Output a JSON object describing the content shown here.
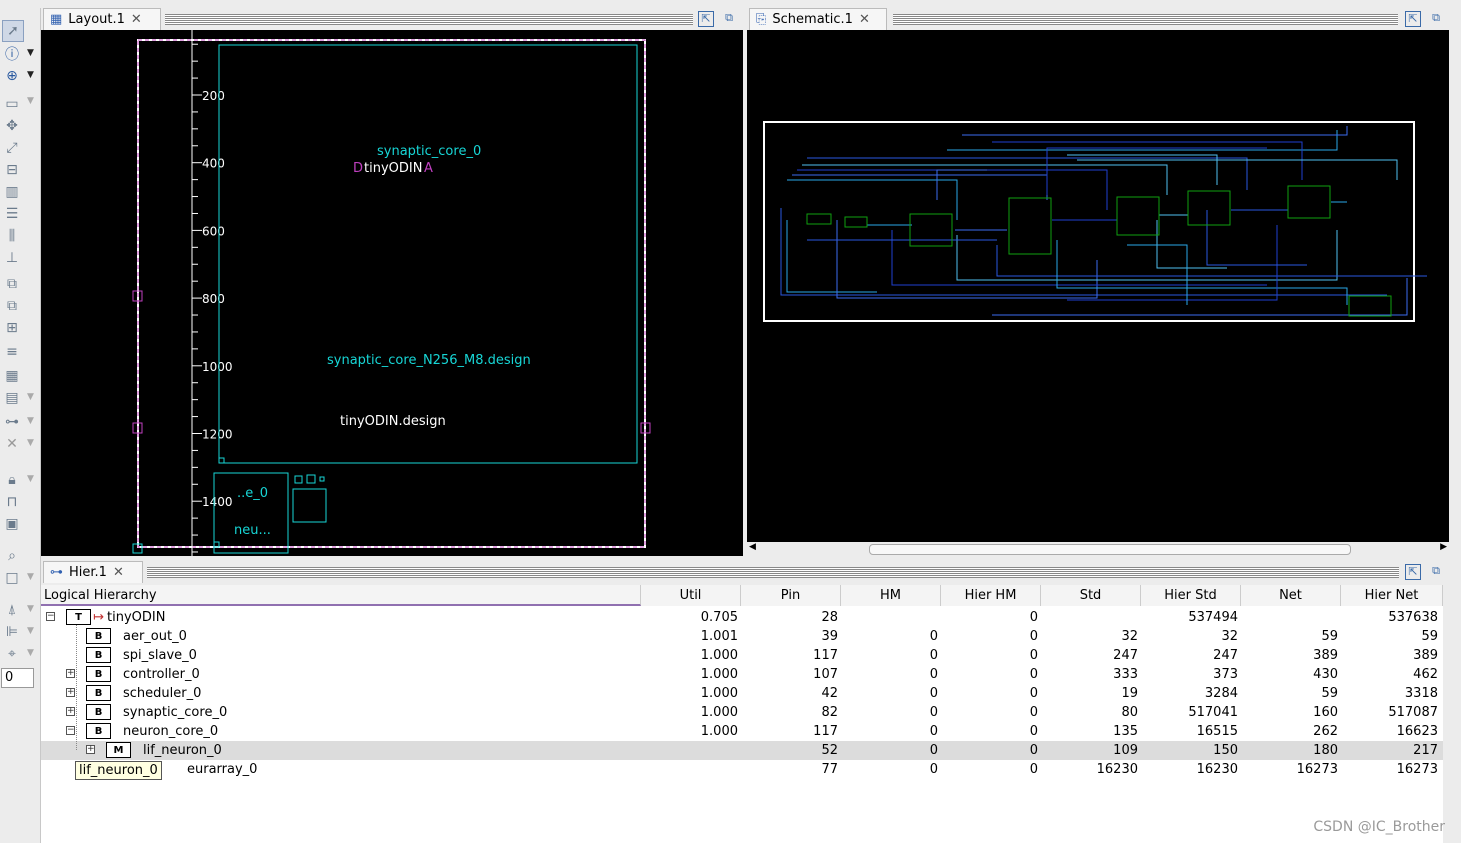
{
  "toolbar": {
    "zoom_value": "0"
  },
  "layout_tab": {
    "title": "Layout.1"
  },
  "schematic_tab": {
    "title": "Schematic.1"
  },
  "hier_tab": {
    "title": "Hier.1"
  },
  "layout": {
    "ruler_labels": [
      "200",
      "400",
      "600",
      "800",
      "1000",
      "1200",
      "1400"
    ],
    "labels": {
      "synaptic_core": "synaptic_core_0",
      "tinyodin": "tinyODIN",
      "overlap_left": "D",
      "overlap_right": "A",
      "synaptic_design": "synaptic_core_N256_M8.design",
      "tinyodin_design": "tinyODIN.design",
      "e0": "..e_0",
      "neu": "neu..."
    }
  },
  "hier": {
    "columns": [
      "Logical Hierarchy",
      "Util",
      "Pin",
      "HM",
      "Hier HM",
      "Std",
      "Hier Std",
      "Net",
      "Hier Net"
    ],
    "rows": [
      {
        "badge": "T",
        "name": "tinyODIN",
        "util": "0.705",
        "pin": "28",
        "hm": "",
        "hier_hm": "0",
        "std": "",
        "hier_std": "537494",
        "net": "",
        "hier_net": "537638"
      },
      {
        "badge": "B",
        "name": "aer_out_0",
        "util": "1.001",
        "pin": "39",
        "hm": "0",
        "hier_hm": "0",
        "std": "32",
        "hier_std": "32",
        "net": "59",
        "hier_net": "59"
      },
      {
        "badge": "B",
        "name": "spi_slave_0",
        "util": "1.000",
        "pin": "117",
        "hm": "0",
        "hier_hm": "0",
        "std": "247",
        "hier_std": "247",
        "net": "389",
        "hier_net": "389"
      },
      {
        "badge": "B",
        "name": "controller_0",
        "util": "1.000",
        "pin": "107",
        "hm": "0",
        "hier_hm": "0",
        "std": "333",
        "hier_std": "373",
        "net": "430",
        "hier_net": "462"
      },
      {
        "badge": "B",
        "name": "scheduler_0",
        "util": "1.000",
        "pin": "42",
        "hm": "0",
        "hier_hm": "0",
        "std": "19",
        "hier_std": "3284",
        "net": "59",
        "hier_net": "3318"
      },
      {
        "badge": "B",
        "name": "synaptic_core_0",
        "util": "1.000",
        "pin": "82",
        "hm": "0",
        "hier_hm": "0",
        "std": "80",
        "hier_std": "517041",
        "net": "160",
        "hier_net": "517087"
      },
      {
        "badge": "B",
        "name": "neuron_core_0",
        "util": "1.000",
        "pin": "117",
        "hm": "0",
        "hier_hm": "0",
        "std": "135",
        "hier_std": "16515",
        "net": "262",
        "hier_net": "16623"
      },
      {
        "badge": "M",
        "name": "lif_neuron_0",
        "util": "",
        "pin": "52",
        "hm": "0",
        "hier_hm": "0",
        "std": "109",
        "hier_std": "150",
        "net": "180",
        "hier_net": "217"
      },
      {
        "badge": "",
        "name": "eurarray_0",
        "util": "",
        "pin": "77",
        "hm": "0",
        "hier_hm": "0",
        "std": "16230",
        "hier_std": "16230",
        "net": "16273",
        "hier_net": "16273"
      }
    ]
  },
  "tooltip": {
    "text": "lif_neuron_0"
  },
  "watermark": "CSDN @IC_Brother",
  "colors": {
    "cyan": "#17d6d6",
    "magenta": "#c040c0",
    "green": "#0fa00f",
    "blue": "#2040e0"
  }
}
